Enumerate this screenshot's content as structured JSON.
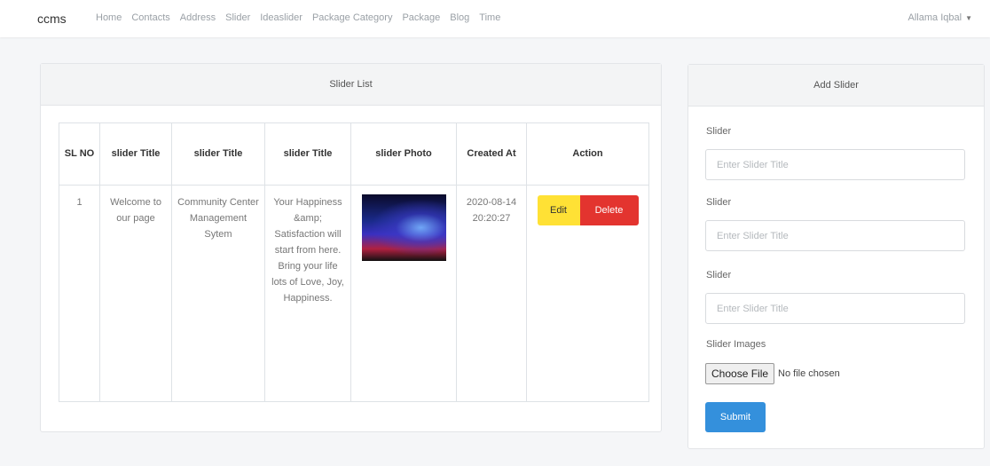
{
  "navbar": {
    "brand": "ccms",
    "links": [
      "Home",
      "Contacts",
      "Address",
      "Slider",
      "Ideaslider",
      "Package Category",
      "Package",
      "Blog",
      "Time"
    ],
    "user": "Allama Iqbal"
  },
  "list_card": {
    "title": "Slider List",
    "headers": [
      "SL NO",
      "slider Title",
      "slider Title",
      "slider Title",
      "slider Photo",
      "Created At",
      "Action"
    ],
    "rows": [
      {
        "sl": "1",
        "title1": "Welcome to our page",
        "title2": "Community Center Management Sytem",
        "title3": "Your Happiness &amp; Satisfaction will start from here. Bring your life lots of Love, Joy, Happiness.",
        "created": "2020-08-14 20:20:27",
        "edit_label": "Edit",
        "delete_label": "Delete"
      }
    ]
  },
  "form_card": {
    "title": "Add Slider",
    "fields": [
      {
        "label": "Slider",
        "placeholder": "Enter Slider Title"
      },
      {
        "label": "Slider",
        "placeholder": "Enter Slider Title"
      },
      {
        "label": "Slider",
        "placeholder": "Enter Slider Title"
      }
    ],
    "images_label": "Slider Images",
    "choose_file_label": "Choose File",
    "file_status": "No file chosen",
    "submit_label": "Submit"
  },
  "colors": {
    "edit": "#ffe135",
    "delete": "#e3342f",
    "submit": "#3490dc"
  }
}
